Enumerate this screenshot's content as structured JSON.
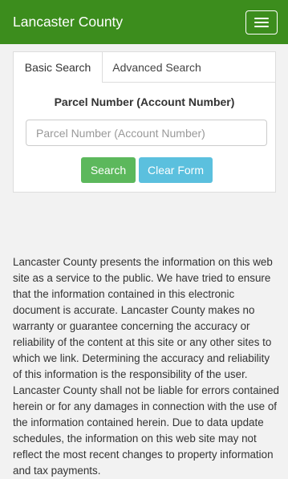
{
  "navbar": {
    "brand": "Lancaster County",
    "menu_icon": "hamburger-menu-icon",
    "color": "#3c8d1d"
  },
  "tabs": [
    {
      "label": "Basic Search",
      "active": true
    },
    {
      "label": "Advanced Search",
      "active": false
    }
  ],
  "search": {
    "label": "Parcel Number (Account Number)",
    "placeholder": "Parcel Number (Account Number)",
    "value": "",
    "search_button": "Search",
    "clear_button": "Clear Form",
    "search_color": "#5cb85c",
    "clear_color": "#5bc0de"
  },
  "disclaimer": "Lancaster County presents the information on this web site as a service to the public. We have tried to ensure that the information contained in this electronic document is accurate. Lancaster County makes no warranty or guarantee concerning the accuracy or reliability of the content at this site or any other sites to which we link. Determining the accuracy and reliability of this information is the responsibility of the user. Lancaster County shall not be liable for errors contained herein or for any damages in connection with the use of the information contained herein. Due to data update schedules, the information on this web site may not reflect the most recent changes to property information and tax payments."
}
